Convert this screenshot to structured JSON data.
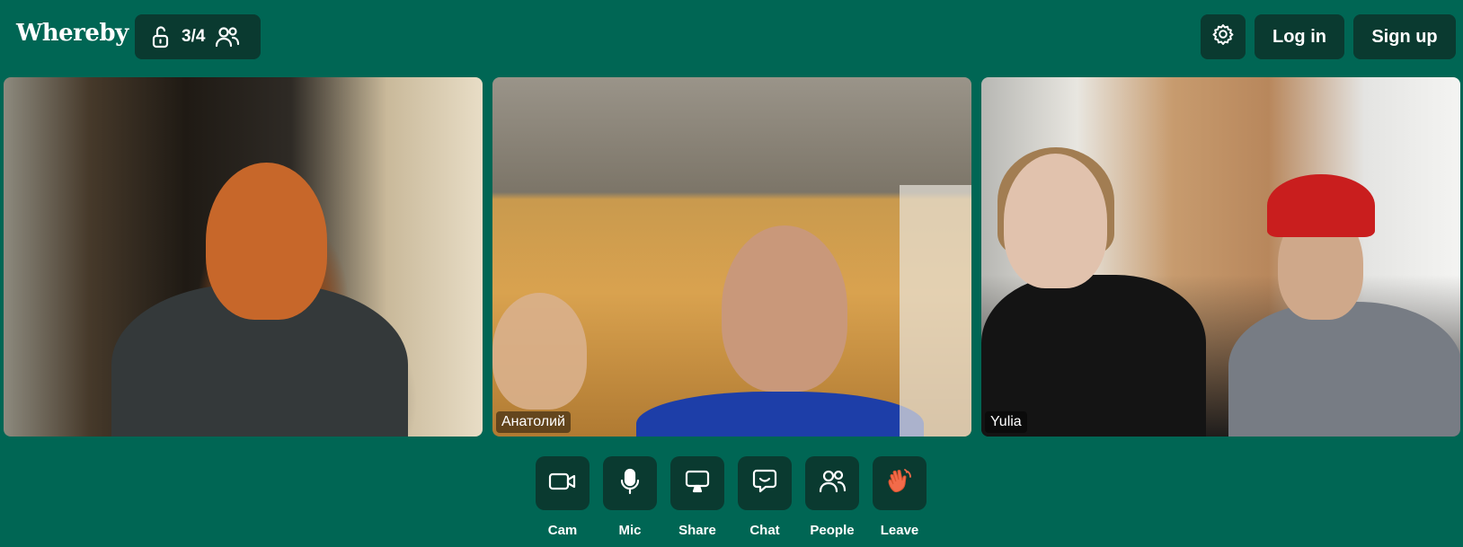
{
  "header": {
    "logo": "Whereby",
    "room": {
      "count": "3/4",
      "lock_icon": "unlock-icon",
      "people_icon": "people-icon"
    },
    "settings_icon": "gear-icon",
    "login_label": "Log in",
    "signup_label": "Sign up"
  },
  "tiles": [
    {
      "name": ""
    },
    {
      "name": "Анатолий"
    },
    {
      "name": "Yulia"
    }
  ],
  "toolbar": [
    {
      "label": "Cam",
      "icon": "camera-icon"
    },
    {
      "label": "Mic",
      "icon": "microphone-icon"
    },
    {
      "label": "Share",
      "icon": "screen-share-icon"
    },
    {
      "label": "Chat",
      "icon": "chat-icon"
    },
    {
      "label": "People",
      "icon": "people-icon"
    },
    {
      "label": "Leave",
      "icon": "waving-hand-icon"
    }
  ],
  "colors": {
    "background": "#006654",
    "dark": "#0a3a30",
    "leave": "#f26b4a"
  }
}
